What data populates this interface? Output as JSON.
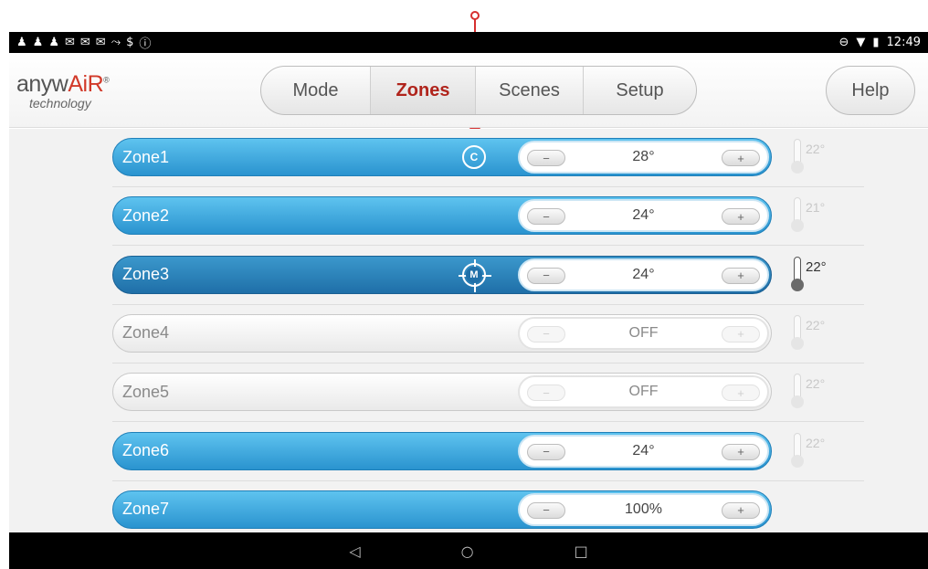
{
  "status_bar": {
    "left_icons": [
      "♟",
      "♟",
      "♟",
      "✉",
      "✉",
      "✉",
      "⤳",
      "$",
      "ⓘ"
    ],
    "right_icons": [
      "⊖",
      "▼",
      "▮"
    ],
    "time": "12:49"
  },
  "header": {
    "logo_main": "anyw",
    "logo_accent": "AiR",
    "logo_sup": "®",
    "logo_sub": "technology",
    "tabs": [
      {
        "label": "Mode",
        "active": false
      },
      {
        "label": "Zones",
        "active": true
      },
      {
        "label": "Scenes",
        "active": false
      },
      {
        "label": "Setup",
        "active": false
      }
    ],
    "help_label": "Help"
  },
  "zones": [
    {
      "name": "Zone1",
      "state": "on",
      "icon": "C",
      "value": "28°",
      "temp": "22°",
      "thermo_active": false
    },
    {
      "name": "Zone2",
      "state": "on",
      "icon": "",
      "value": "24°",
      "temp": "21°",
      "thermo_active": false
    },
    {
      "name": "Zone3",
      "state": "selected",
      "icon": "M",
      "value": "24°",
      "temp": "22°",
      "thermo_active": true
    },
    {
      "name": "Zone4",
      "state": "off",
      "icon": "",
      "value": "OFF",
      "temp": "22°",
      "thermo_active": false
    },
    {
      "name": "Zone5",
      "state": "off",
      "icon": "",
      "value": "OFF",
      "temp": "22°",
      "thermo_active": false
    },
    {
      "name": "Zone6",
      "state": "on",
      "icon": "",
      "value": "24°",
      "temp": "22°",
      "thermo_active": false
    },
    {
      "name": "Zone7",
      "state": "on",
      "icon": "",
      "value": "100%",
      "temp": "",
      "thermo_active": false
    }
  ],
  "controls": {
    "minus": "−",
    "plus": "+"
  },
  "nav_bar": {
    "back": "◁",
    "home": "○",
    "recents": "□"
  },
  "colors": {
    "accent_red": "#b0241c",
    "zone_blue": "#2a93cf",
    "zone_selected": "#1f6fa8"
  }
}
